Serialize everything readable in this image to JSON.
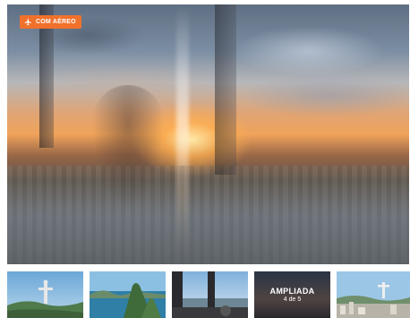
{
  "badge": {
    "label": "COM AÉREO",
    "icon": "airplane-icon",
    "color": "#f0712b"
  },
  "hero": {
    "alt_subject": "sunset-from-helicopter"
  },
  "thumbnails": [
    {
      "subject": "christ-redeemer"
    },
    {
      "subject": "sugarloaf-bay"
    },
    {
      "subject": "helicopter-cockpit"
    },
    {
      "subject": "sunset-expanded",
      "title": "AMPLIADA",
      "subtitle": "4 de 5"
    },
    {
      "subject": "christ-redeemer-city"
    }
  ]
}
